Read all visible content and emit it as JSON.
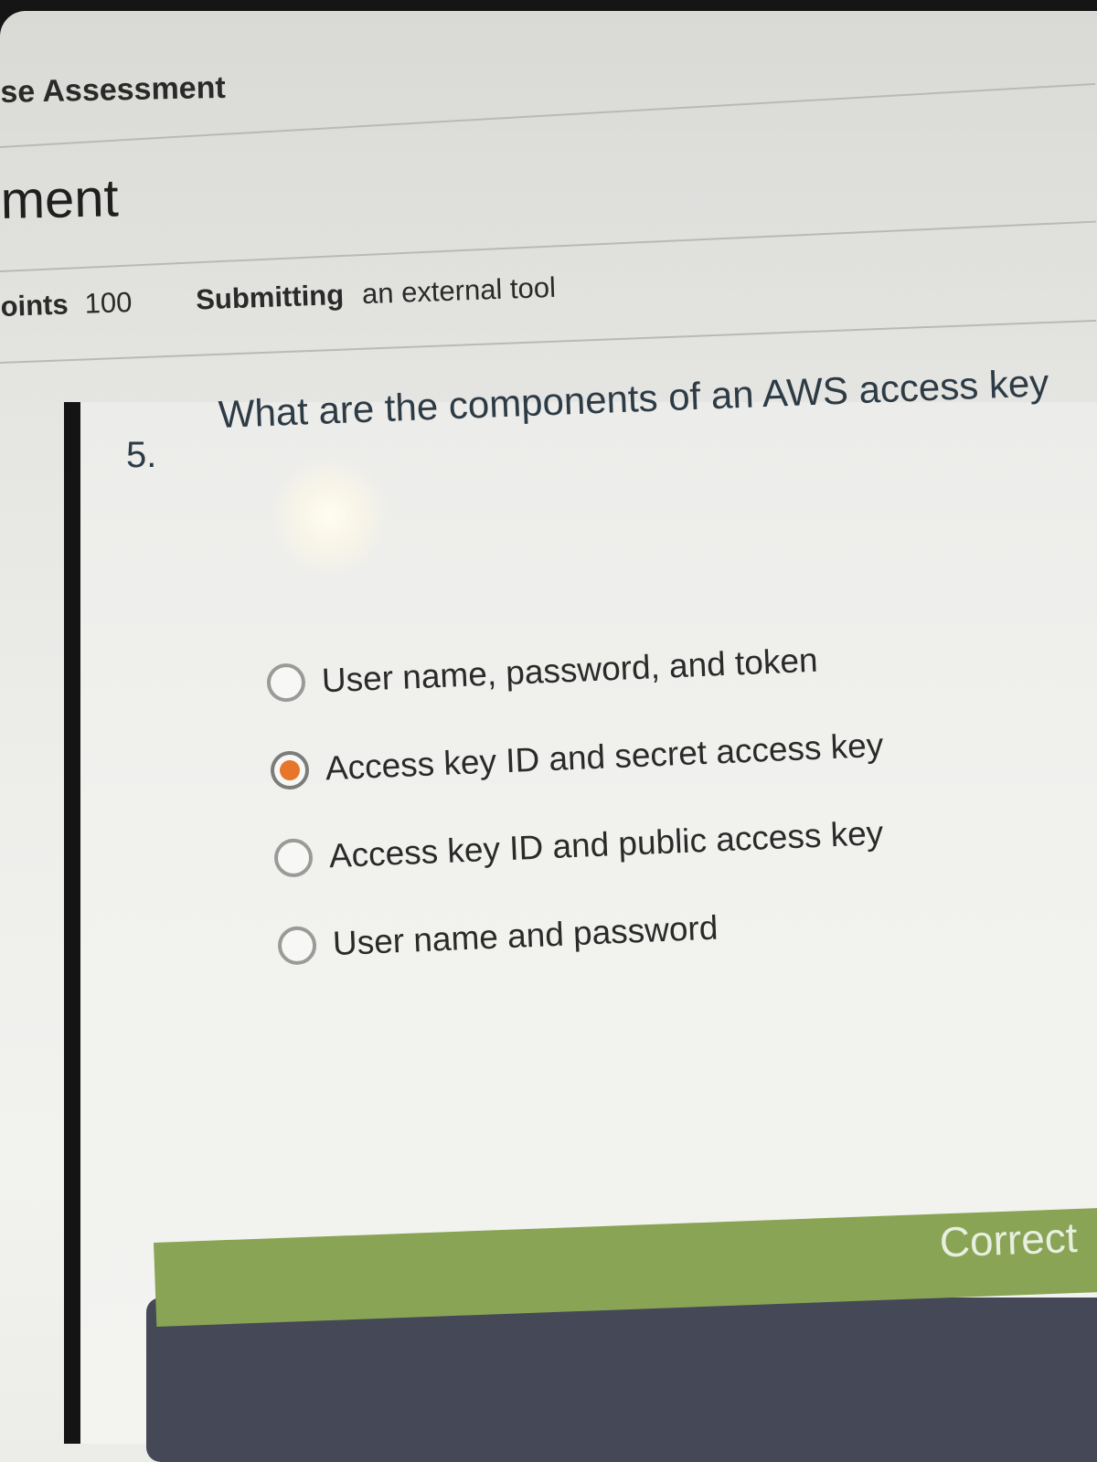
{
  "breadcrumb": "se Assessment",
  "page_title": "ment",
  "meta": {
    "points_label": "oints",
    "points_value": "100",
    "submitting_label": "Submitting",
    "submitting_value": "an external tool"
  },
  "question": {
    "number": "5.",
    "text": "What are the components of an AWS access key",
    "answers": [
      {
        "label": "User name, password, and token",
        "selected": false
      },
      {
        "label": "Access key ID and secret access key",
        "selected": true
      },
      {
        "label": "Access key ID and public access key",
        "selected": false
      },
      {
        "label": "User name and password",
        "selected": false
      }
    ]
  },
  "result": {
    "status": "Correct",
    "color": "#89a454"
  },
  "colors": {
    "selected_radio": "#e8762a",
    "footer_panel": "#444857"
  }
}
